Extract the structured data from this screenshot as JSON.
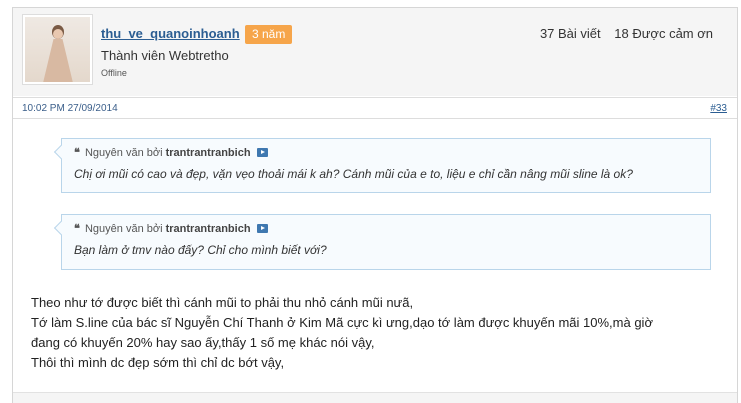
{
  "user": {
    "name": "thu_ve_quanoinhoanh",
    "badge": "3 năm",
    "title": "Thành viên Webtretho",
    "status": "Offline",
    "posts": "37 Bài viết",
    "thanks": "18 Được cảm ơn"
  },
  "post": {
    "datetime": "10:02 PM 27/09/2014",
    "number": "#33"
  },
  "quotes": [
    {
      "prefix": "Nguyên văn bởi",
      "author": "trantrantranbich",
      "text": "Chị ơi mũi có cao và đẹp, vặn vẹo thoải mái k ah? Cánh mũi của e to, liệu e chỉ cần nâng mũi sline là ok?"
    },
    {
      "prefix": "Nguyên văn bởi",
      "author": "trantrantranbich",
      "text": "Bạn làm ở tmv nào đấy? Chỉ cho mình biết với?"
    }
  ],
  "body_lines": [
    "Theo như tớ được biết thì cánh mũi to phải thu nhỏ cánh mũi nưã,",
    "Tớ làm S.line của bác sĩ Nguyễn Chí Thanh ở Kim Mã cực kì ưng,dạo tớ làm được khuyến mãi 10%,mà giờ",
    "đang có khuyến 20% hay sao ấy,thấy 1 số mẹ khác nói vậy,",
    "Thôi thì mình dc đẹp sớm thì chỉ dc bớt vậy,"
  ],
  "icons": {
    "quote": "quote-icon",
    "view_post": "view-post-icon"
  },
  "colors": {
    "link": "#2b5d92",
    "badge": "#f6a54a",
    "quote_border": "#b9d5ea"
  }
}
